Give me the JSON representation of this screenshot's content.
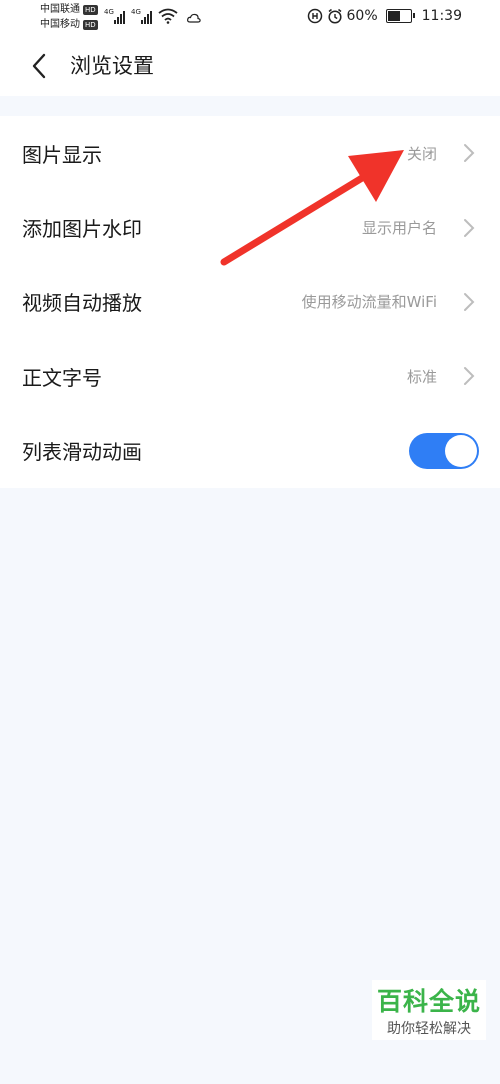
{
  "status_bar": {
    "carrier_1": "中国联通",
    "carrier_2": "中国移动",
    "hd_badge": "HD",
    "network_type": "4G",
    "battery_percent": "60%",
    "battery_level": 0.6,
    "time": "11:39"
  },
  "header": {
    "title": "浏览设置"
  },
  "settings": {
    "items": [
      {
        "label": "图片显示",
        "value": "关闭"
      },
      {
        "label": "添加图片水印",
        "value": "显示用户名"
      },
      {
        "label": "视频自动播放",
        "value": "使用移动流量和WiFi"
      },
      {
        "label": "正文字号",
        "value": "标准"
      },
      {
        "label": "列表滑动动画",
        "toggle_on": true
      }
    ]
  },
  "watermark": {
    "title": "百科全说",
    "subtitle": "助你轻松解决"
  },
  "colors": {
    "accent": "#2f7ef5",
    "annotation_arrow": "#f0332a",
    "watermark_green": "#3bb44a"
  }
}
